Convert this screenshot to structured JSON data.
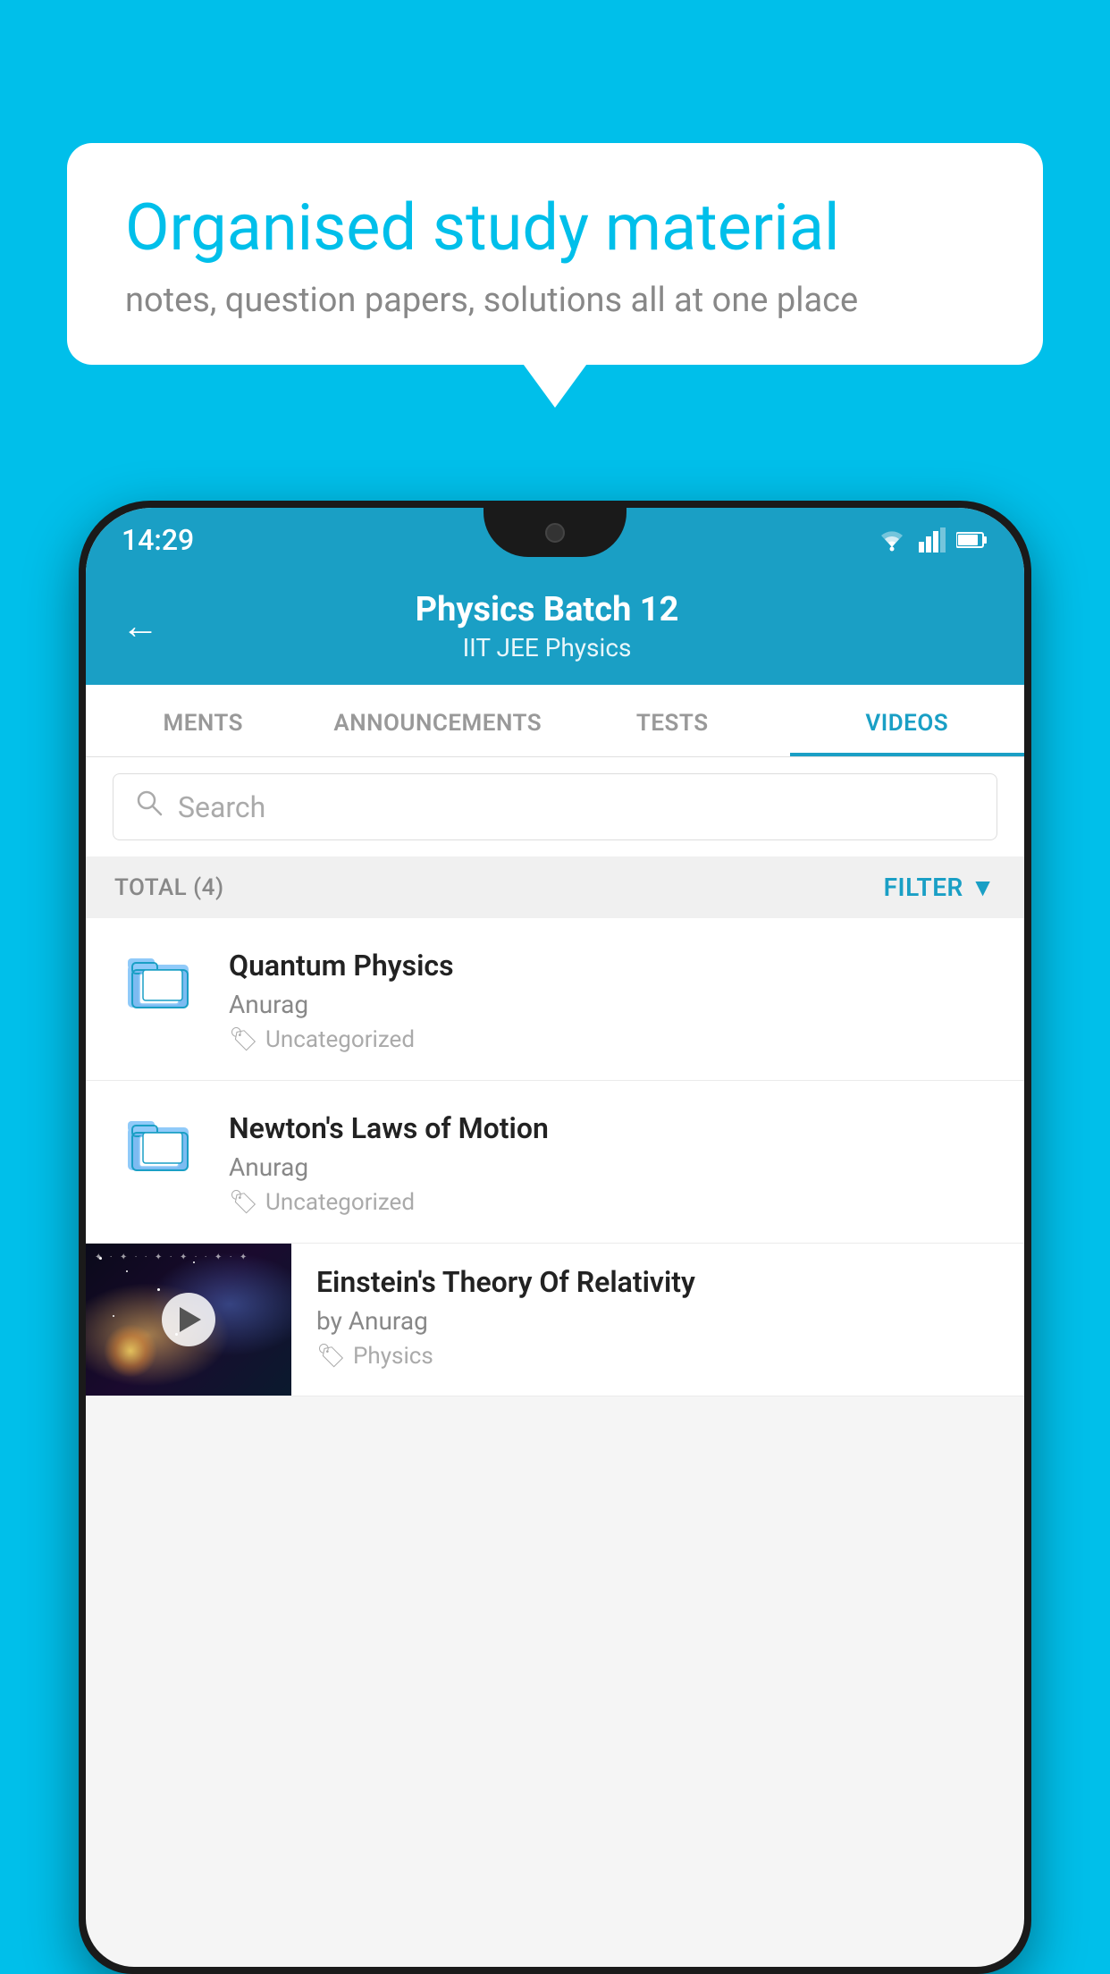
{
  "background": {
    "color": "#00BFEA"
  },
  "speech_bubble": {
    "title": "Organised study material",
    "subtitle": "notes, question papers, solutions all at one place"
  },
  "phone": {
    "status_bar": {
      "time": "14:29"
    },
    "header": {
      "title": "Physics Batch 12",
      "subtitle": "IIT JEE   Physics",
      "back_label": "←"
    },
    "tabs": [
      {
        "label": "MENTS",
        "active": false
      },
      {
        "label": "ANNOUNCEMENTS",
        "active": false
      },
      {
        "label": "TESTS",
        "active": false
      },
      {
        "label": "VIDEOS",
        "active": true
      }
    ],
    "search": {
      "placeholder": "Search"
    },
    "filter_bar": {
      "total_label": "TOTAL (4)",
      "filter_label": "FILTER"
    },
    "videos": [
      {
        "id": 1,
        "title": "Quantum Physics",
        "author": "Anurag",
        "tag": "Uncategorized",
        "type": "folder"
      },
      {
        "id": 2,
        "title": "Newton's Laws of Motion",
        "author": "Anurag",
        "tag": "Uncategorized",
        "type": "folder"
      },
      {
        "id": 3,
        "title": "Einstein's Theory Of Relativity",
        "author": "by Anurag",
        "tag": "Physics",
        "type": "video"
      }
    ]
  }
}
